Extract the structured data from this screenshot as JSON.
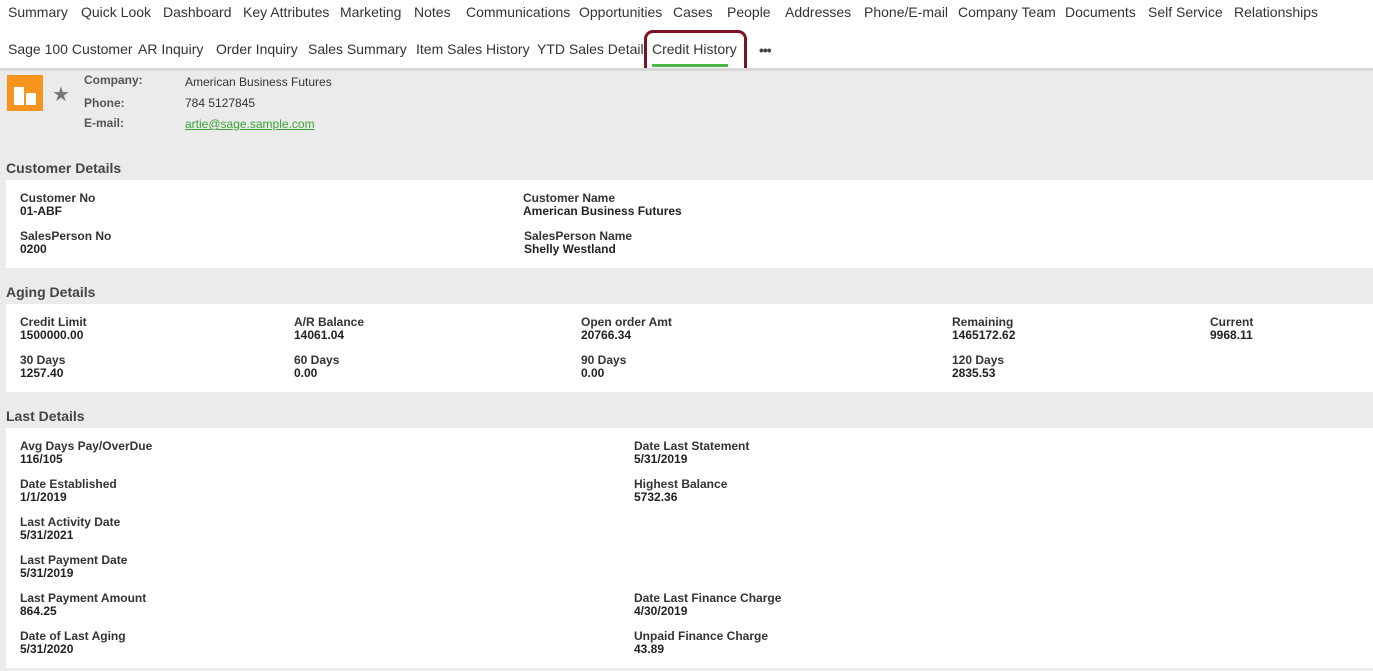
{
  "tabs_row1": [
    "Summary",
    "Quick Look",
    "Dashboard",
    "Key Attributes",
    "Marketing",
    "Notes",
    "Communications",
    "Opportunities",
    "Cases",
    "People",
    "Addresses",
    "Phone/E-mail",
    "Company Team",
    "Documents",
    "Self Service",
    "Relationships"
  ],
  "tabs_row2": [
    "Sage 100 Customer",
    "AR Inquiry",
    "Order Inquiry",
    "Sales Summary",
    "Item Sales History",
    "YTD Sales Detail",
    "Credit History"
  ],
  "active_tab": "Credit History",
  "more_label": "•••",
  "header": {
    "company_label": "Company:",
    "company_value": "American Business Futures",
    "phone_label": "Phone:",
    "phone_value": "784 5127845",
    "email_label": "E-mail:",
    "email_value": "artie@sage.sample.com"
  },
  "customer_details": {
    "title": "Customer Details",
    "customer_no_label": "Customer No",
    "customer_no": "01-ABF",
    "customer_name_label": "Customer Name",
    "customer_name": "American Business Futures",
    "salesperson_no_label": "SalesPerson No",
    "salesperson_no": "0200",
    "salesperson_name_label": "SalesPerson Name",
    "salesperson_name": "Shelly Westland"
  },
  "aging_details": {
    "title": "Aging Details",
    "credit_limit_label": "Credit Limit",
    "credit_limit": "1500000.00",
    "ar_balance_label": "A/R Balance",
    "ar_balance": "14061.04",
    "open_order_label": "Open order Amt",
    "open_order": "20766.34",
    "remaining_label": "Remaining",
    "remaining": "1465172.62",
    "current_label": "Current",
    "current": "9968.11",
    "d30_label": "30 Days",
    "d30": "1257.40",
    "d60_label": "60 Days",
    "d60": "0.00",
    "d90_label": "90 Days",
    "d90": "0.00",
    "d120_label": "120 Days",
    "d120": "2835.53"
  },
  "last_details": {
    "title": "Last Details",
    "avg_days_label": "Avg Days Pay/OverDue",
    "avg_days": "116/105",
    "date_last_statement_label": "Date Last Statement",
    "date_last_statement": "5/31/2019",
    "date_established_label": "Date Established",
    "date_established": "1/1/2019",
    "highest_balance_label": "Highest Balance",
    "highest_balance": "5732.36",
    "last_activity_label": "Last Activity Date",
    "last_activity": "5/31/2021",
    "last_payment_date_label": "Last Payment Date",
    "last_payment_date": "5/31/2019",
    "last_payment_amount_label": "Last Payment Amount",
    "last_payment_amount": "864.25",
    "date_last_finance_label": "Date Last Finance Charge",
    "date_last_finance": "4/30/2019",
    "date_last_aging_label": "Date of Last Aging",
    "date_last_aging": "5/31/2020",
    "unpaid_finance_label": "Unpaid Finance Charge",
    "unpaid_finance": "43.89"
  }
}
